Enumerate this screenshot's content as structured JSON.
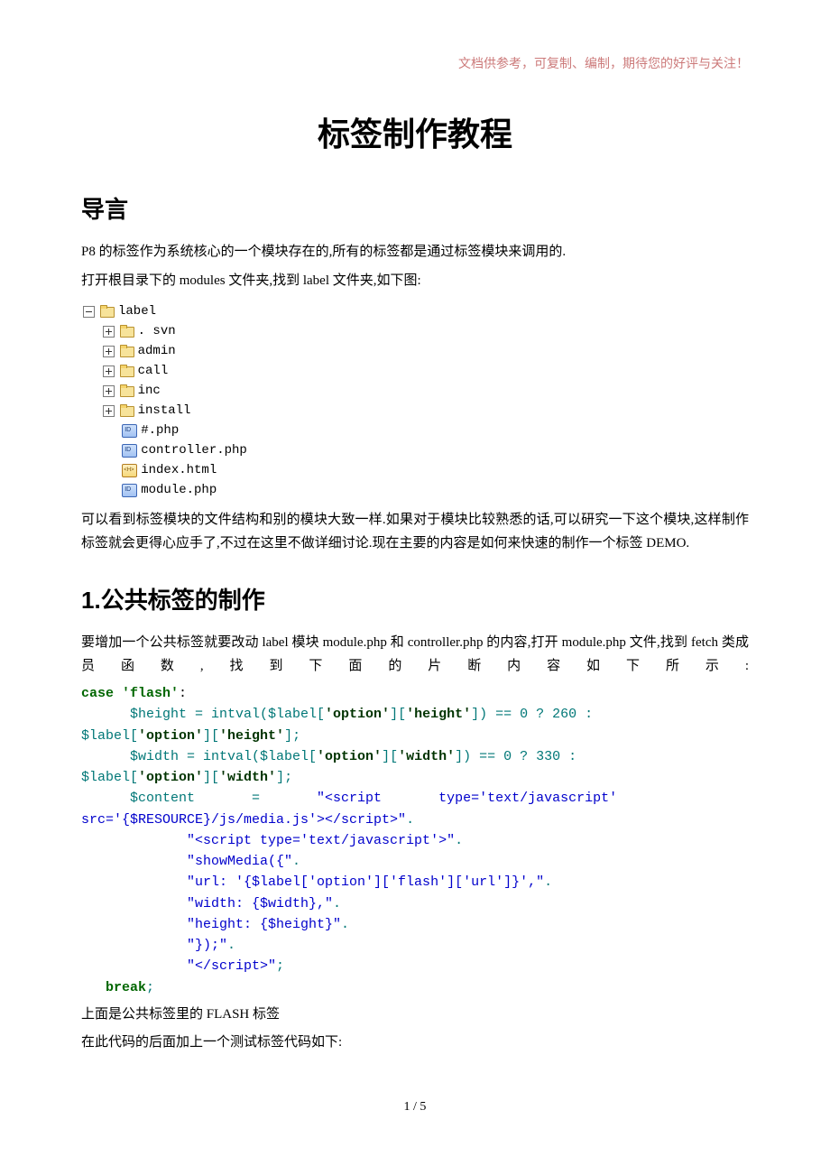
{
  "header_note": "文档供参考，可复制、编制，期待您的好评与关注！",
  "title": "标签制作教程",
  "section_intro": "导言",
  "intro_p1": "P8 的标签作为系统核心的一个模块存在的,所有的标签都是通过标签模块来调用的.",
  "intro_p2": "打开根目录下的 modules 文件夹,找到 label 文件夹,如下图:",
  "tree": {
    "root": "label",
    "folders": [
      ". svn",
      "admin",
      "call",
      "inc",
      "install"
    ],
    "files": [
      {
        "name": "#.php",
        "type": "php"
      },
      {
        "name": "controller.php",
        "type": "php"
      },
      {
        "name": "index.html",
        "type": "html"
      },
      {
        "name": "module.php",
        "type": "php"
      }
    ]
  },
  "intro_p3": "可以看到标签模块的文件结构和别的模块大致一样.如果对于模块比较熟悉的话,可以研究一下这个模块,这样制作标签就会更得心应手了,不过在这里不做详细讨论.现在主要的内容是如何来快速的制作一个标签 DEMO.",
  "section1_num": "1.",
  "section1_title": "公共标签的制作",
  "section1_p1": "要增加一个公共标签就要改动 label 模块 module.php 和 controller.php 的内容,打开 module.php 文件,找到 fetch 类成员函数,找到下面的片断内容如下所示:",
  "code": {
    "l1_case": "case ",
    "l1_flash": "'flash'",
    "l1_colon": ":",
    "l2": "      $height = intval($label[",
    "l2_opt": "'option'",
    "l2_mid": "][",
    "l2_height": "'height'",
    "l2_end": "]) == 0 ? 260 :",
    "l3_pre": "$label[",
    "l3_opt": "'option'",
    "l3_mid": "][",
    "l3_height": "'height'",
    "l3_end": "];",
    "l4": "      $width = intval($label[",
    "l4_opt": "'option'",
    "l4_mid": "][",
    "l4_width": "'width'",
    "l4_end": "]) == 0 ? 330 :",
    "l5_pre": "$label[",
    "l5_opt": "'option'",
    "l5_mid": "][",
    "l5_width": "'width'",
    "l5_end": "];",
    "l6a": "      $content       =       ",
    "l6b": "\"<script       type='text/javascript'",
    "l7": "src='{$RESOURCE}/js/media.js'></script>\"",
    "l7_dot": ".",
    "l8": "             \"<script type='text/javascript'>\"",
    "l8_dot": ".",
    "l9": "             \"showMedia({\"",
    "l9_dot": ".",
    "l10": "             \"url: '{$label['option']['flash']['url']}',\"",
    "l10_dot": ".",
    "l11": "             \"width: {$width},\"",
    "l11_dot": ".",
    "l12": "             \"height: {$height}\"",
    "l12_dot": ".",
    "l13": "             \"});\"",
    "l13_dot": ".",
    "l14": "             \"</script>\"",
    "l14_semi": ";",
    "l15_break": "   break",
    "l15_semi": ";"
  },
  "after_code_p1": "上面是公共标签里的 FLASH 标签",
  "after_code_p2": "在此代码的后面加上一个测试标签代码如下:",
  "page_number": "1 / 5"
}
